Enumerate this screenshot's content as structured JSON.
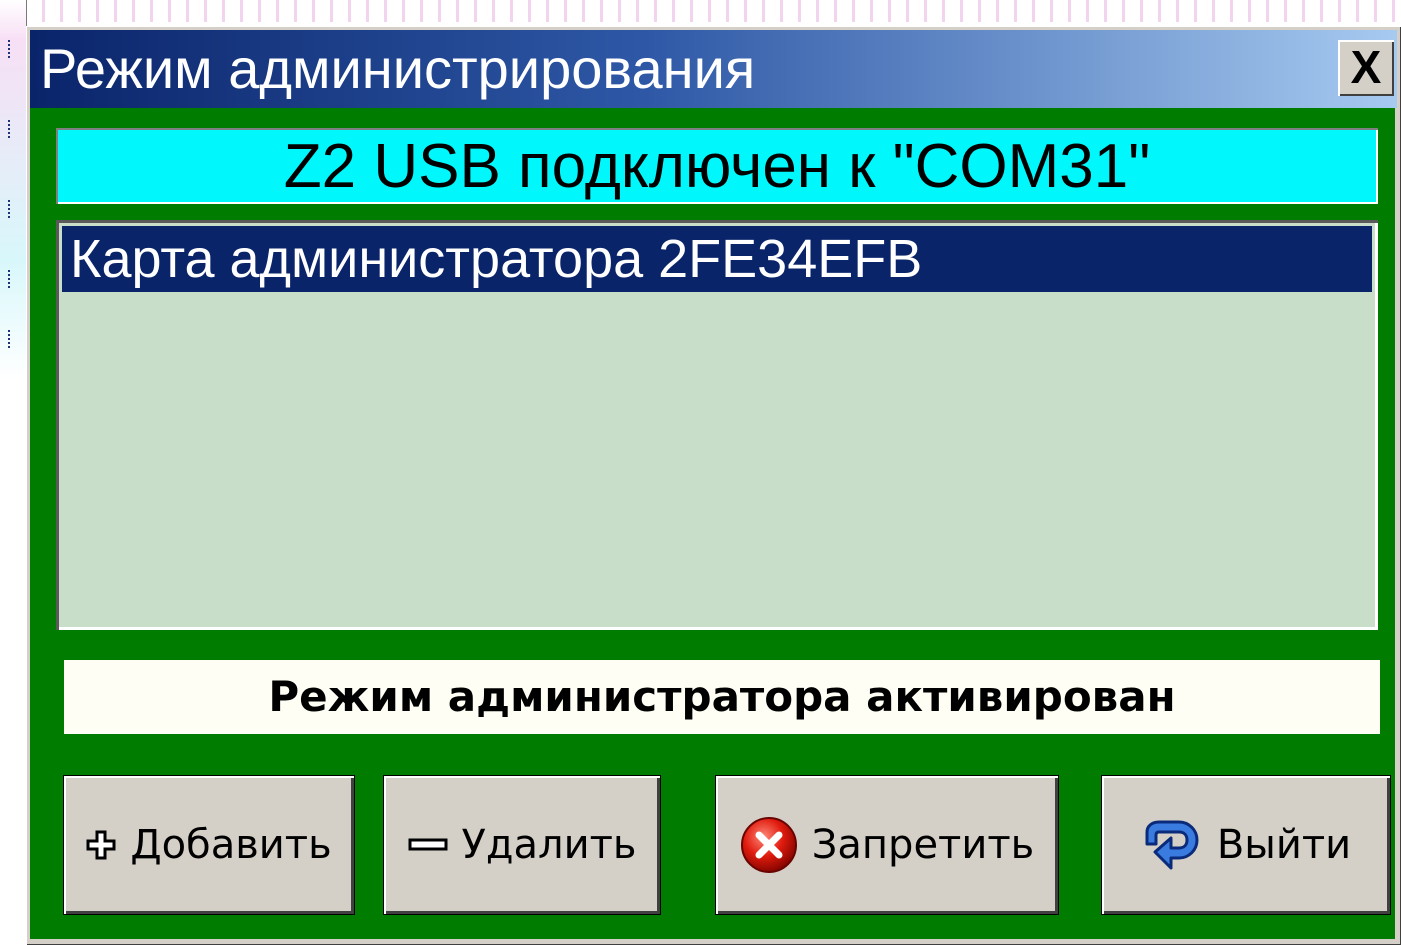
{
  "window": {
    "title": "Режим администрирования",
    "close_label": "X"
  },
  "status": {
    "text": "Z2 USB подключен к \"COM31\""
  },
  "card_list": {
    "items": [
      {
        "label": "Карта администратора 2FE34EFB",
        "selected": true
      }
    ]
  },
  "message": {
    "text": "Режим администратора активирован"
  },
  "buttons": {
    "add": {
      "label": "Добавить",
      "icon": "plus-icon"
    },
    "delete": {
      "label": "Удалить",
      "icon": "minus-icon"
    },
    "deny": {
      "label": "Запретить",
      "icon": "red-x-circle-icon"
    },
    "exit": {
      "label": "Выйти",
      "icon": "return-arrow-icon"
    }
  },
  "colors": {
    "title_gradient_start": "#0a246a",
    "title_gradient_end": "#a6caf0",
    "client_background": "#007d00",
    "status_background": "#00f8fd",
    "list_background": "#c8dec8",
    "selection": "#0a246a",
    "message_background": "#fffef4"
  }
}
